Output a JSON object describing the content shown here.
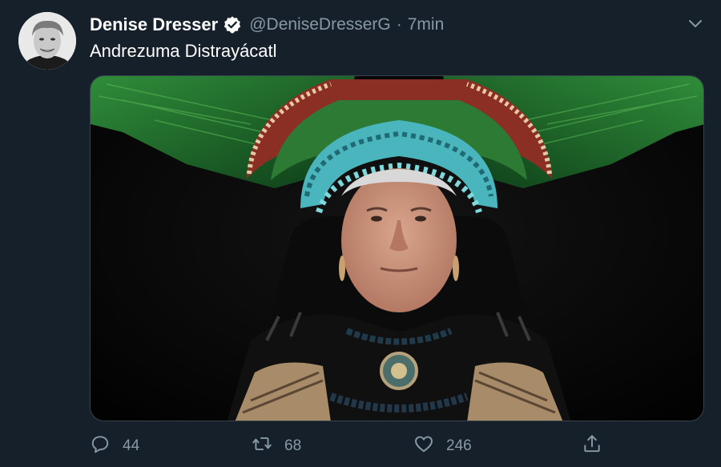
{
  "tweet": {
    "display_name": "Denise Dresser",
    "verified_icon": "verified-badge-icon",
    "handle": "@DeniseDresserG",
    "separator": "·",
    "time": "7min",
    "text": "Andrezuma Distrayácatl",
    "more_icon": "chevron-down-icon",
    "media_description_icon": "photo"
  },
  "actions": {
    "reply": {
      "icon": "reply-icon",
      "count": "44"
    },
    "retweet": {
      "icon": "retweet-icon",
      "count": "68"
    },
    "like": {
      "icon": "heart-icon",
      "count": "246"
    },
    "share": {
      "icon": "share-icon"
    }
  },
  "colors": {
    "background": "#15202b",
    "secondary_text": "#8899a6",
    "verified": "#ffffff",
    "border": "#38444d"
  }
}
